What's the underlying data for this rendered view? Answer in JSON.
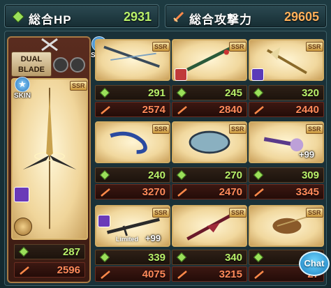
{
  "summary": {
    "hp_label": "総合HP",
    "hp_value": "2931",
    "atk_label": "総合攻撃力",
    "atk_value": "29605"
  },
  "main_weapon": {
    "class_label_line1": "DUAL",
    "class_label_line2": "BLADE",
    "skin_label": "SKIN",
    "rarity": "SSR",
    "hp": "287",
    "atk": "2596"
  },
  "skin_badges": [
    "SKIN",
    "SKIN"
  ],
  "weapons": [
    {
      "rarity": "SSR",
      "hp": "291",
      "atk": "2574",
      "plus": "",
      "limited": ""
    },
    {
      "rarity": "SSR",
      "hp": "245",
      "atk": "2840",
      "plus": "",
      "limited": ""
    },
    {
      "rarity": "SSR",
      "hp": "320",
      "atk": "2440",
      "plus": "",
      "limited": ""
    },
    {
      "rarity": "SSR",
      "hp": "240",
      "atk": "3270",
      "plus": "",
      "limited": ""
    },
    {
      "rarity": "SSR",
      "hp": "270",
      "atk": "2470",
      "plus": "",
      "limited": ""
    },
    {
      "rarity": "SSR",
      "hp": "309",
      "atk": "3345",
      "plus": "+99",
      "limited": ""
    },
    {
      "rarity": "SSR",
      "hp": "339",
      "atk": "4075",
      "plus": "+99",
      "limited": "Limited"
    },
    {
      "rarity": "SSR",
      "hp": "340",
      "atk": "3215",
      "plus": "",
      "limited": ""
    },
    {
      "rarity": "SSR",
      "hp": "2",
      "atk": "27",
      "plus": "",
      "limited": ""
    }
  ],
  "chat": {
    "label": "Chat"
  },
  "colors": {
    "hp": "#b9f06a",
    "atk": "#ff8a5a",
    "frame": "#d1ad65"
  }
}
